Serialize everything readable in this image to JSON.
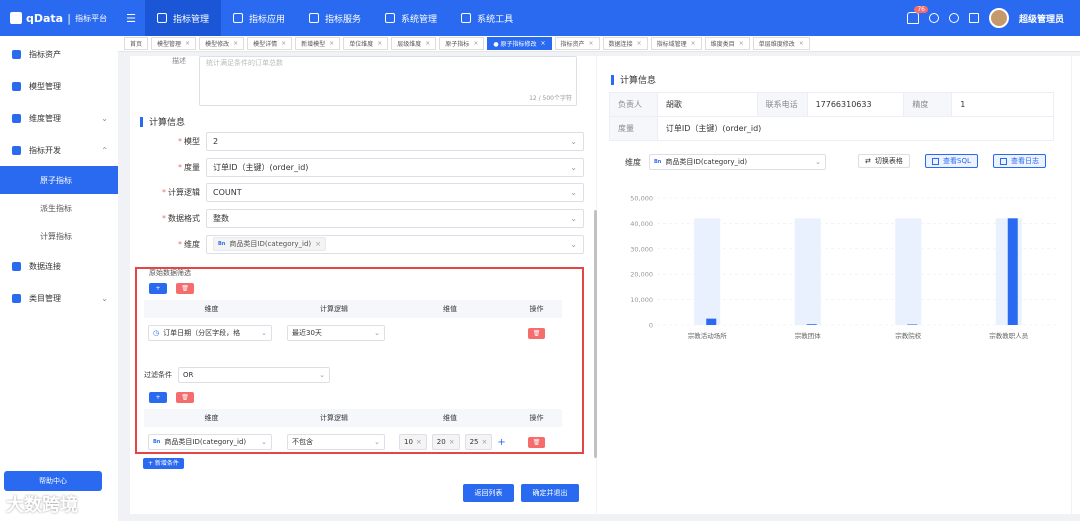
{
  "topbar": {
    "logo": "qData",
    "subtitle": "指标平台",
    "nav": [
      {
        "label": "指标管理",
        "active": true
      },
      {
        "label": "指标应用",
        "active": false
      },
      {
        "label": "指标服务",
        "active": false
      },
      {
        "label": "系统管理",
        "active": false
      },
      {
        "label": "系统工具",
        "active": false
      }
    ],
    "notification_count": "76",
    "username": "超级管理员"
  },
  "sidebar": {
    "items": [
      {
        "label": "指标资产",
        "arrow": ""
      },
      {
        "label": "模型管理",
        "arrow": ""
      },
      {
        "label": "维度管理",
        "arrow": "⌄"
      },
      {
        "label": "指标开发",
        "arrow": "⌃"
      }
    ],
    "subitems": [
      {
        "label": "原子指标",
        "active": true
      },
      {
        "label": "派生指标",
        "active": false
      },
      {
        "label": "计算指标",
        "active": false
      }
    ],
    "items2": [
      {
        "label": "数据连接",
        "arrow": ""
      },
      {
        "label": "类目管理",
        "arrow": "⌄"
      }
    ],
    "help": "帮助中心",
    "watermark": "大数跨境"
  },
  "tabs": [
    {
      "label": "首页",
      "closable": false,
      "active": false
    },
    {
      "label": "模型管理",
      "closable": true,
      "active": false
    },
    {
      "label": "模型修改",
      "closable": true,
      "active": false
    },
    {
      "label": "模型详情",
      "closable": true,
      "active": false
    },
    {
      "label": "新增模型",
      "closable": true,
      "active": false
    },
    {
      "label": "单位维度",
      "closable": true,
      "active": false
    },
    {
      "label": "层级维度",
      "closable": true,
      "active": false
    },
    {
      "label": "原子指标",
      "closable": true,
      "active": false
    },
    {
      "label": "● 原子指标修改",
      "closable": true,
      "active": true
    },
    {
      "label": "指标资产",
      "closable": true,
      "active": false
    },
    {
      "label": "数据连接",
      "closable": true,
      "active": false
    },
    {
      "label": "指标域管理",
      "closable": true,
      "active": false
    },
    {
      "label": "维度类目",
      "closable": true,
      "active": false
    },
    {
      "label": "单层维度修改",
      "closable": true,
      "active": false
    }
  ],
  "form": {
    "desc_label": "描述",
    "desc_text": "统计满足条件的订单总数",
    "desc_count": "12 / 500个字符",
    "section_title": "计算信息",
    "fields": [
      {
        "label": "模型",
        "value": "2"
      },
      {
        "label": "度量",
        "value": "订单ID（主键）(order_id)"
      },
      {
        "label": "计算逻辑",
        "value": "COUNT"
      },
      {
        "label": "数据格式",
        "value": "整数"
      },
      {
        "label": "维度",
        "value": "商品类目ID(category_id)"
      }
    ],
    "dim_tag_icon": "Bn",
    "filter_title": "原始数据筛选",
    "table_headers": [
      "维度",
      "计算逻辑",
      "维值",
      "操作"
    ],
    "row1": {
      "dim": "订单日期（分区字段，格",
      "logic": "最近30天"
    },
    "op_label": "过滤条件",
    "op_value": "OR",
    "row2": {
      "dim_icon": "Bn",
      "dim": "商品类目ID(category_id)",
      "logic": "不包含",
      "values": [
        "10",
        "20",
        "25"
      ]
    },
    "add_condition": "+ 新增条件",
    "back_btn": "返回列表",
    "confirm_btn": "确定并退出"
  },
  "right": {
    "section_title": "计算信息",
    "info": [
      {
        "k": "负责人",
        "v": "胡歌"
      },
      {
        "k": "联系电话",
        "v": "17766310633"
      },
      {
        "k": "精度",
        "v": "1"
      },
      {
        "k": "度量",
        "v": "订单ID（主键）(order_id)"
      }
    ],
    "dim_label": "维度",
    "dim_icon": "Bn",
    "dim_value": "商品类目ID(category_id)",
    "btn_switch": "切换表格",
    "btn_sql": "查看SQL",
    "btn_log": "查看日志"
  },
  "chart_data": {
    "type": "bar",
    "categories": [
      "宗教活动场所",
      "宗教团体",
      "宗教院校",
      "宗教教职人员"
    ],
    "series": [
      {
        "values": [
          42000,
          42000,
          42000,
          42000
        ],
        "color": "#e8f1fd"
      },
      {
        "values": [
          2500,
          300,
          200,
          42000
        ],
        "color": "#2a6af0"
      }
    ],
    "ylim": [
      0,
      50000
    ],
    "yticks": [
      "0",
      "10,000",
      "20,000",
      "30,000",
      "40,000",
      "50,000"
    ],
    "grid": true
  }
}
